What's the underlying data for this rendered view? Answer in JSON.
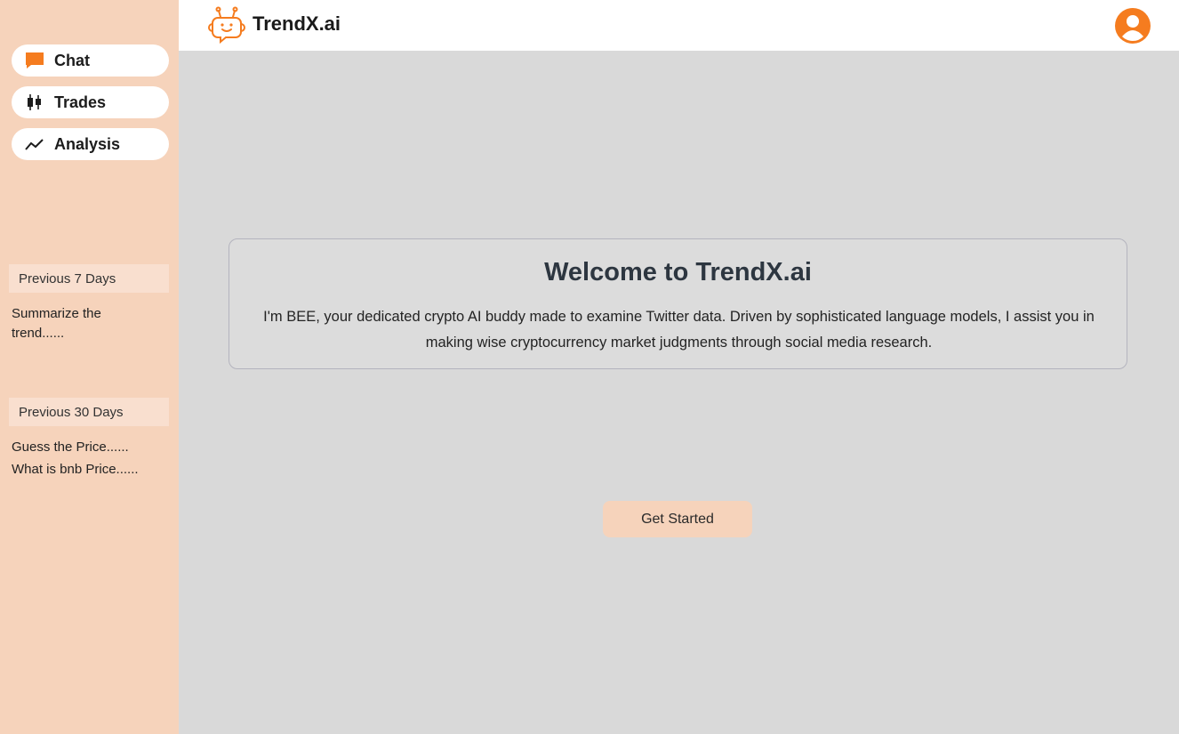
{
  "brand": {
    "name": "TrendX.ai"
  },
  "sidebar": {
    "nav": [
      {
        "label": "Chat",
        "icon": "chat-icon"
      },
      {
        "label": "Trades",
        "icon": "candlestick-icon"
      },
      {
        "label": "Analysis",
        "icon": "trend-line-icon"
      }
    ],
    "sections": [
      {
        "title": "Previous 7 Days",
        "items": [
          "Summarize the trend......"
        ]
      },
      {
        "title": "Previous 30 Days",
        "items": [
          "Guess the Price......",
          "What is bnb Price......"
        ]
      }
    ]
  },
  "header": {
    "avatar_icon": "user-avatar-icon"
  },
  "main": {
    "welcome_title": "Welcome to TrendX.ai",
    "welcome_text": "I'm BEE, your dedicated crypto AI buddy made to examine Twitter data. Driven by sophisticated language models, I assist you in making wise cryptocurrency market judgments through social media research.",
    "cta_label": "Get Started"
  },
  "colors": {
    "accent": "#f57c1f",
    "sidebar_bg": "#f6d3bb",
    "main_bg": "#d9d9d9"
  }
}
